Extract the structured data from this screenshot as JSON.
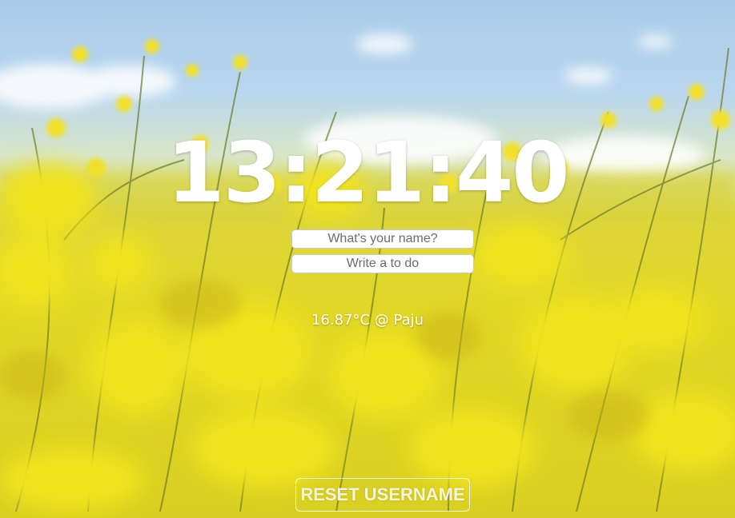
{
  "clock": {
    "time": "13:21:40"
  },
  "login_form": {
    "name_placeholder": "What's your name?"
  },
  "todo_form": {
    "todo_placeholder": "Write a to do"
  },
  "weather": {
    "text": "16.87°C @ Paju"
  },
  "reset_button": {
    "label": "RESET USERNAME"
  },
  "background": {
    "description_colors": {
      "sky": "#b3d1ec",
      "flowers": "#e4d822"
    }
  }
}
